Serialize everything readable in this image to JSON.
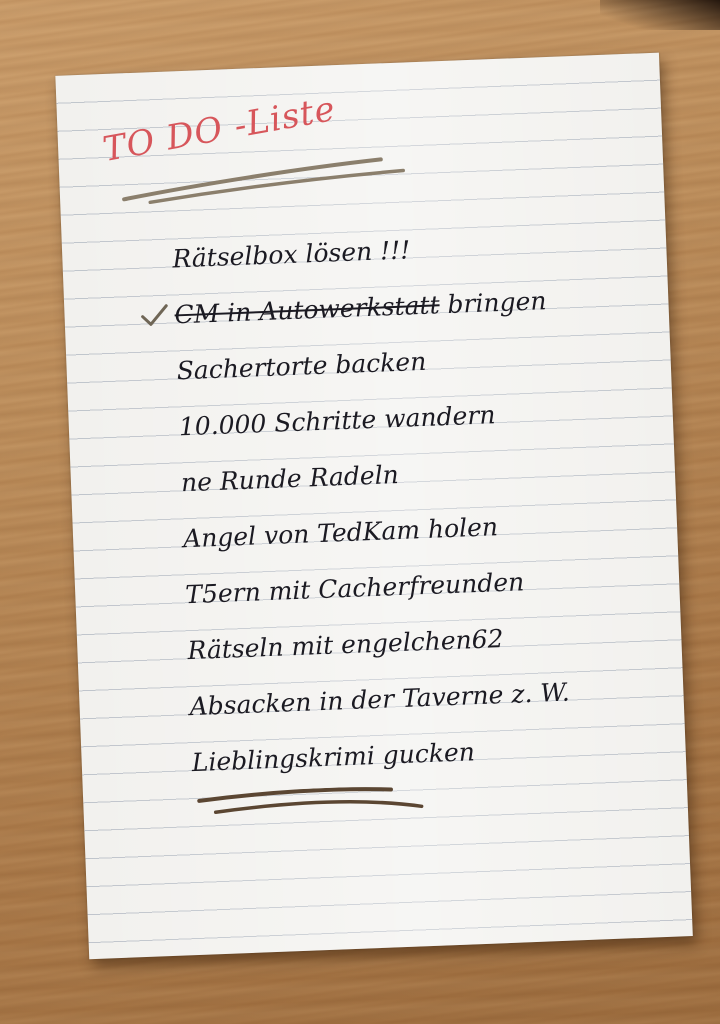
{
  "note": {
    "title": "TO DO -Liste",
    "title_color": "#d7565b",
    "ink_color": "#1b1a22",
    "items": [
      {
        "text": "Rätselbox lösen !!!",
        "done": false
      },
      {
        "text_struck": "CM in Autowerkstatt",
        "text_rest": " bringen",
        "done": true
      },
      {
        "text": "Sachertorte backen",
        "done": false
      },
      {
        "text": "10.000 Schritte wandern",
        "done": false
      },
      {
        "text": "ne Runde Radeln",
        "done": false
      },
      {
        "text": "Angel von TedKam holen",
        "done": false
      },
      {
        "text": "T5ern mit Cacherfreunden",
        "done": false
      },
      {
        "text": "Rätseln mit engelchen62",
        "done": false
      },
      {
        "text": "Absacken in der Taverne z. W.",
        "done": false
      },
      {
        "text": "Lieblingskrimi gucken",
        "done": false
      }
    ]
  },
  "icons": {
    "checkmark": "check-icon"
  }
}
